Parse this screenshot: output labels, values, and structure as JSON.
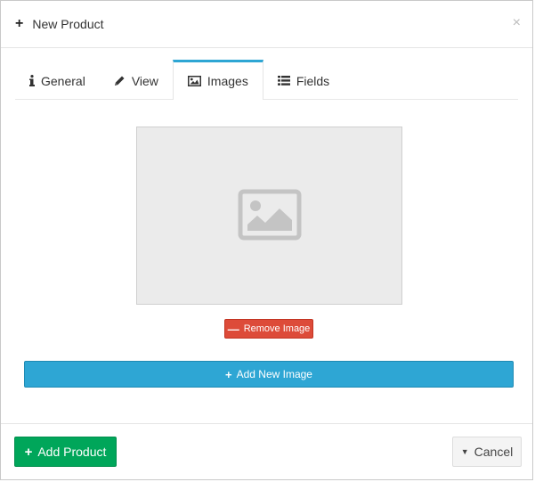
{
  "header": {
    "title": "New Product",
    "title_icon": "+",
    "close_glyph": "×"
  },
  "tabs": [
    {
      "label": "General",
      "icon": "info-icon",
      "active": false
    },
    {
      "label": "View",
      "icon": "pencil-icon",
      "active": false
    },
    {
      "label": "Images",
      "icon": "image-icon",
      "active": true
    },
    {
      "label": "Fields",
      "icon": "fields-icon",
      "active": false
    }
  ],
  "image_panel": {
    "placeholder_icon": "image-placeholder-icon",
    "remove_label": "Remove Image",
    "add_label": "Add New Image"
  },
  "footer": {
    "add_product_label": "Add Product",
    "cancel_label": "Cancel"
  },
  "colors": {
    "accent": "#2ea6d4",
    "success": "#00a65a",
    "danger": "#dd4b39",
    "cancel_bg": "#f4f4f4"
  }
}
